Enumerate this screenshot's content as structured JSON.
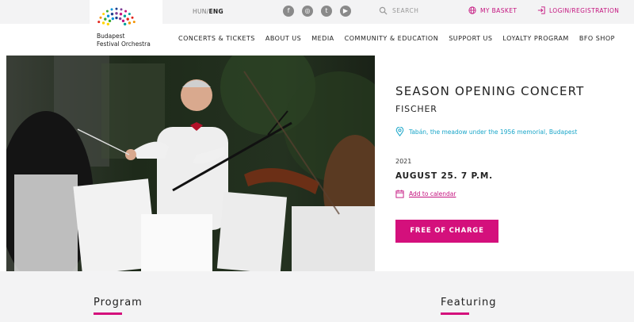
{
  "brand": {
    "line1": "Budapest",
    "line2": "Festival Orchestra"
  },
  "topbar": {
    "lang_hun": "HUN",
    "lang_sep": "/",
    "lang_eng": "ENG",
    "socials": [
      "f",
      "◎",
      "t",
      "▶"
    ],
    "search_label": "SEARCH",
    "basket_label": "MY BASKET",
    "login_label": "LOGIN/REGISTRATION"
  },
  "nav": {
    "items": [
      "CONCERTS & TICKETS",
      "ABOUT US",
      "MEDIA",
      "COMMUNITY & EDUCATION",
      "SUPPORT US",
      "LOYALTY PROGRAM",
      "BFO SHOP"
    ]
  },
  "event": {
    "title": "SEASON OPENING CONCERT",
    "subtitle": "FISCHER",
    "venue": "Tabán, the meadow under the 1956 memorial, Budapest",
    "year": "2021",
    "date": "AUGUST 25. 7 P.M.",
    "calendar_link": "Add to calendar",
    "cta": "FREE OF CHARGE"
  },
  "sections": {
    "program": "Program",
    "featuring": "Featuring"
  },
  "colors": {
    "accent": "#d4107c",
    "venue": "#1aa6c9",
    "background": "#f3f3f4"
  }
}
